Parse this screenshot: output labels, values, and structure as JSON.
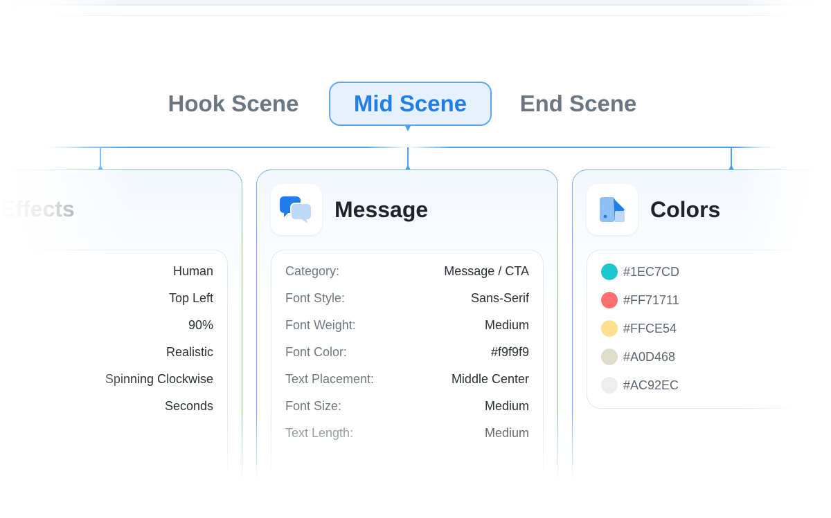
{
  "tabs": {
    "hook": "Hook Scene",
    "mid": "Mid Scene",
    "end": "End Scene"
  },
  "left_card": {
    "title": "Effects",
    "values": [
      "Human",
      "Top Left",
      "90%",
      "Realistic",
      "Spinning Clockwise",
      "Seconds"
    ]
  },
  "message_card": {
    "title": "Message",
    "icon": "chat-bubbles-icon",
    "rows": [
      {
        "label": "Category:",
        "value": "Message / CTA"
      },
      {
        "label": "Font Style:",
        "value": "Sans-Serif"
      },
      {
        "label": "Font Weight:",
        "value": "Medium"
      },
      {
        "label": "Font Color:",
        "value": "#f9f9f9"
      },
      {
        "label": "Text Placement:",
        "value": "Middle Center"
      },
      {
        "label": "Font Size:",
        "value": "Medium"
      },
      {
        "label": "Text Length:",
        "value": "Medium"
      }
    ]
  },
  "colors_card": {
    "title": "Colors",
    "icon": "color-swatch-icon",
    "swatches": [
      {
        "hex": "#1EC7CD"
      },
      {
        "hex": "#FF71711"
      },
      {
        "hex": "#FFCE54"
      },
      {
        "hex": "#A0D468"
      },
      {
        "hex": "#AC92EC"
      }
    ],
    "dot_colors": [
      "#1ec7cd",
      "#ff7171",
      "#ffce54",
      "#dedccb",
      "#eceef1"
    ]
  },
  "colors": {
    "accent": "#1f7ee8",
    "connector": "#4a9ef0"
  }
}
